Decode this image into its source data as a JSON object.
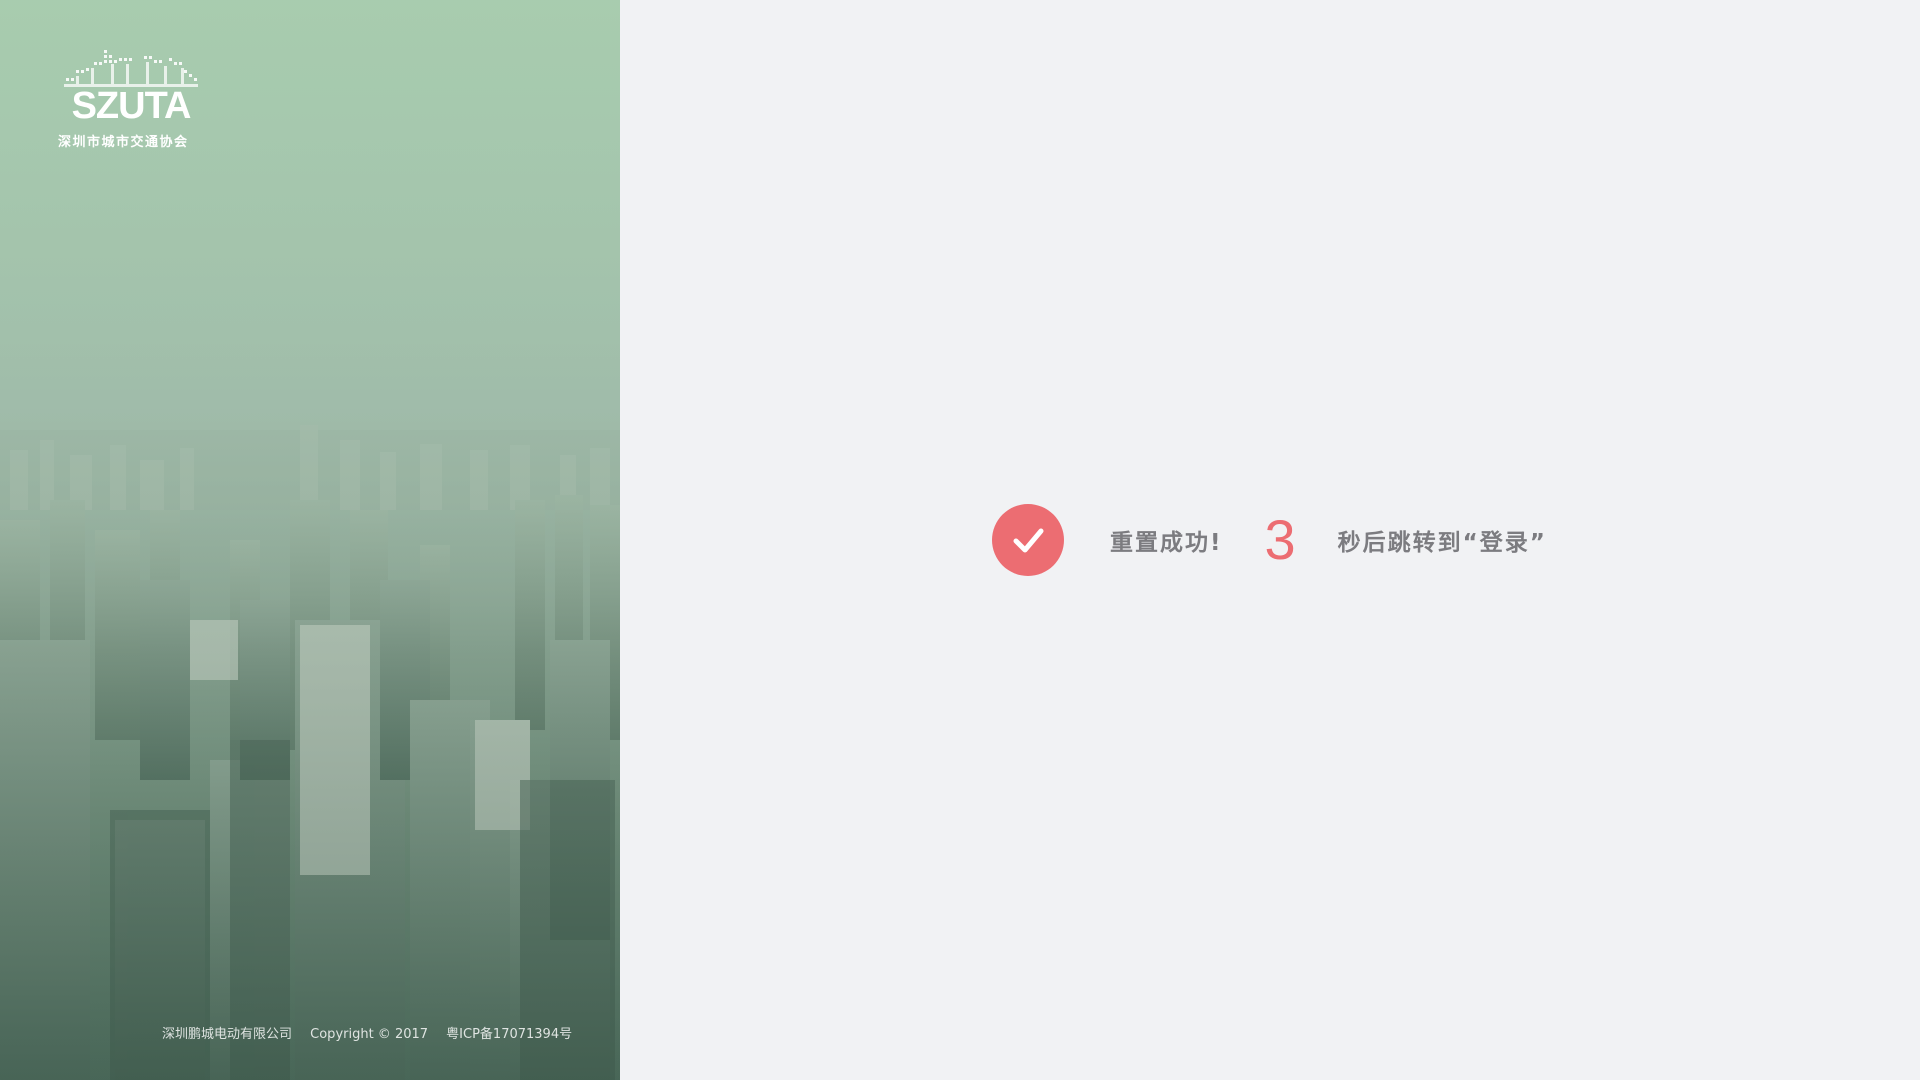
{
  "brand": {
    "logo_text": "SZUTA",
    "subtitle": "深圳市城市交通协会"
  },
  "footer": {
    "company": "深圳鹏城电动有限公司",
    "copyright": "Copyright © 2017",
    "icp": "粤ICP备17071394号"
  },
  "status": {
    "icon": "check-icon",
    "message": "重置成功!",
    "countdown": "3",
    "redirect_text": "秒后跳转到“登录”"
  },
  "colors": {
    "accent": "#ec6d72",
    "text_muted": "#7c7c80",
    "background": "#f1f2f4"
  }
}
